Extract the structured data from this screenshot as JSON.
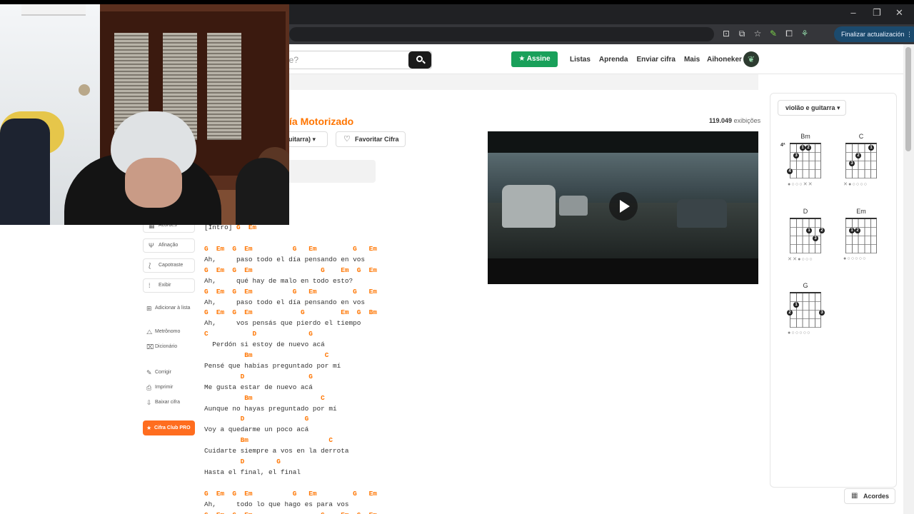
{
  "browser": {
    "update_label": "Finalizar actualización",
    "controls": {
      "minimize": "–",
      "restore": "❐",
      "close": "✕"
    },
    "toolbar_icons": [
      "install-icon",
      "translate-icon",
      "star-icon",
      "extension-leaf-icon",
      "puzzle-icon",
      "profile-icon"
    ]
  },
  "header": {
    "search_placeholder": "je?",
    "assine_label": "Assine",
    "nav": [
      "Listas",
      "Aprenda",
      "Enviar cifra",
      "Mais"
    ],
    "username": "Aihoneker"
  },
  "song": {
    "artist_fragment": "ía Motorizado",
    "views_count": "119.049",
    "views_label": "exibições",
    "tuning_fragment": "uitarra)",
    "favorite_label": "Favoritar Cifra"
  },
  "tools": {
    "acordes": "Acordes",
    "afinacao": "Afinação",
    "capotraste": "Capotraste",
    "exibir": "Exibir",
    "adicionar": "Adicionar à lista",
    "metronomo": "Metrônomo",
    "dicionario": "Dicionário",
    "corrigir": "Corrigir",
    "imprimir": "Imprimir",
    "baixar": "Baixar cifra",
    "pro": "Cifra Club PRO"
  },
  "cifra": {
    "intro_label": "[Intro] ",
    "intro_chords": "G  Em",
    "lines": [
      {
        "t": "c",
        "s": "G  Em  G  Em          G   Em         G   Em"
      },
      {
        "t": "l",
        "s": "Ah,     paso todo el día pensando en vos"
      },
      {
        "t": "c",
        "s": "G  Em  G  Em                 G    Em  G  Em"
      },
      {
        "t": "l",
        "s": "Ah,     qué hay de malo en todo esto?"
      },
      {
        "t": "c",
        "s": "G  Em  G  Em          G   Em         G   Em"
      },
      {
        "t": "l",
        "s": "Ah,     paso todo el día pensando en vos"
      },
      {
        "t": "c",
        "s": "G  Em  G  Em            G         Em  G  Bm"
      },
      {
        "t": "l",
        "s": "Ah,     vos pensás que pierdo el tiempo"
      },
      {
        "t": "c",
        "s": "C           D             G"
      },
      {
        "t": "l",
        "s": "  Perdón si estoy de nuevo acá"
      },
      {
        "t": "c",
        "s": "          Bm                  C"
      },
      {
        "t": "l",
        "s": "Pensé que habías preguntado por mí"
      },
      {
        "t": "c",
        "s": "         D                G"
      },
      {
        "t": "l",
        "s": "Me gusta estar de nuevo acá"
      },
      {
        "t": "c",
        "s": "          Bm                 C"
      },
      {
        "t": "l",
        "s": "Aunque no hayas preguntado por mí"
      },
      {
        "t": "c",
        "s": "         D               G"
      },
      {
        "t": "l",
        "s": "Voy a quedarme un poco acá"
      },
      {
        "t": "c",
        "s": "         Bm                    C"
      },
      {
        "t": "l",
        "s": "Cuidarte siempre a vos en la derrota"
      },
      {
        "t": "c",
        "s": "         D        G"
      },
      {
        "t": "l",
        "s": "Hasta el final, el final"
      },
      {
        "t": "e",
        "s": ""
      },
      {
        "t": "c",
        "s": "G  Em  G  Em          G   Em         G   Em"
      },
      {
        "t": "l",
        "s": "Ah,     todo lo que hago es para vos"
      },
      {
        "t": "c",
        "s": "G  Em  G  Em                 G    Em  G  Em"
      }
    ]
  },
  "chords_panel": {
    "instrument_label": "violão e guitarra",
    "chords": [
      {
        "name": "Bm",
        "fret_label": "4ª",
        "strings": "●○○○✕✕"
      },
      {
        "name": "C",
        "fret_label": "",
        "strings": "✕●○○○○"
      },
      {
        "name": "D",
        "fret_label": "",
        "strings": "✕✕●○○○"
      },
      {
        "name": "Em",
        "fret_label": "",
        "strings": "●○○○○○"
      },
      {
        "name": "G",
        "fret_label": "",
        "strings": "●○○○○○"
      }
    ],
    "acordes_button": "Acordes"
  }
}
